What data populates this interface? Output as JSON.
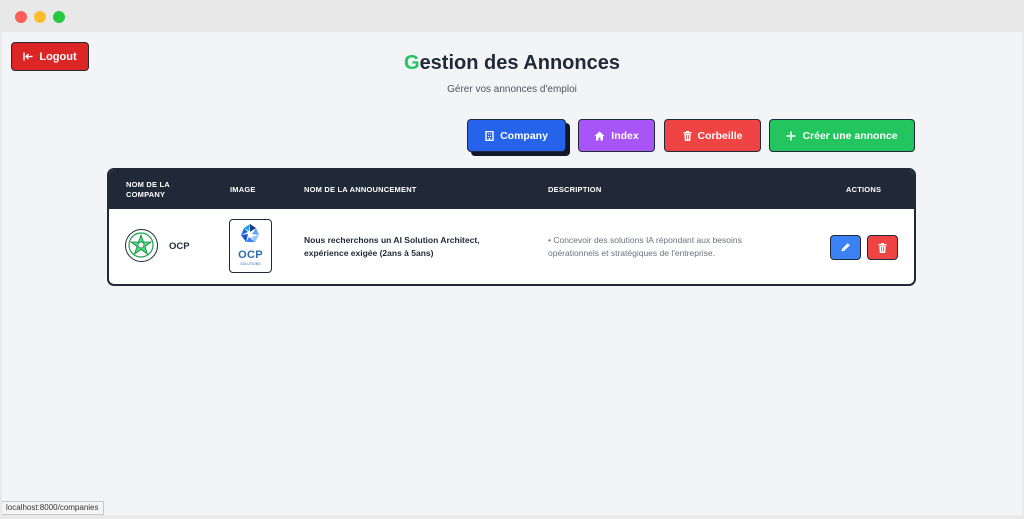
{
  "header": {
    "logout_label": "Logout",
    "title_first_letter": "G",
    "title_rest": "estion des Annonces",
    "subtitle": "Gérer vos annonces d'emploi"
  },
  "toolbar": {
    "company_label": "Company",
    "index_label": "Index",
    "trash_label": "Corbeille",
    "create_label": "Créer une annonce"
  },
  "table": {
    "columns": {
      "company": "NOM DE LA COMPANY",
      "image": "IMAGE",
      "announcement": "NOM DE LA ANNOUNCEMENT",
      "description": "DESCRIPTION",
      "actions": "ACTIONS"
    },
    "rows": [
      {
        "company": "OCP",
        "image_text": "OCP",
        "image_subtext": "SOLUTIONS",
        "announcement": "Nous recherchons un AI Solution Architect, expérience exigée (2ans à 5ans)",
        "description": "• Concevoir des solutions IA répondant aux besoins opérationnels et stratégiques de l'entreprise."
      }
    ]
  },
  "statusbar": {
    "url": "localhost:8000/companies"
  },
  "colors": {
    "accent_green": "#22c55e",
    "primary_blue": "#2563eb",
    "purple": "#a855f7",
    "danger_red": "#ef4444",
    "table_header": "#1f2937"
  },
  "icons": {
    "logout": "logout-arrow-icon",
    "company": "building-icon",
    "index": "home-icon",
    "trash": "trash-icon",
    "create": "plus-icon",
    "edit": "pencil-icon",
    "delete": "trash-icon"
  }
}
